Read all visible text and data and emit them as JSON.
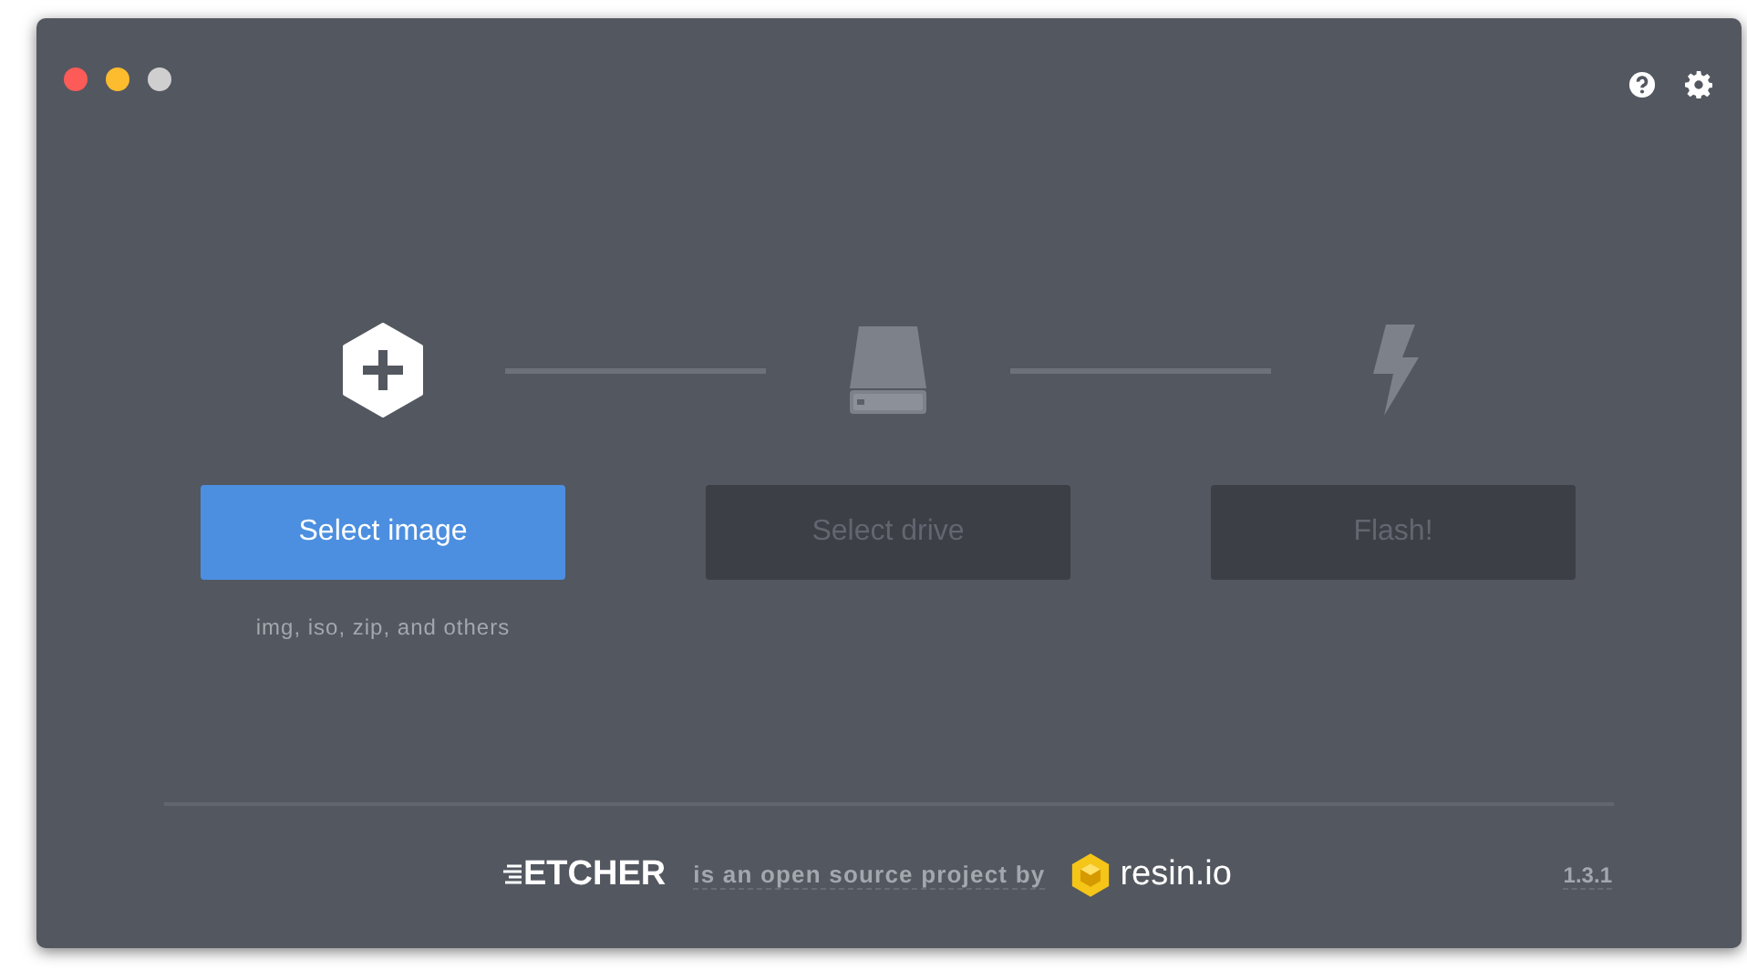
{
  "window": {
    "controls": [
      {
        "color": "#fc5b57"
      },
      {
        "color": "#fdbc2d"
      },
      {
        "color": "#cfcfcf"
      }
    ]
  },
  "steps": [
    {
      "kind": "image",
      "button": "Select image",
      "disabled": false,
      "caption": "img, iso, zip, and others"
    },
    {
      "kind": "drive",
      "button": "Select drive",
      "disabled": true
    },
    {
      "kind": "flash",
      "button": "Flash!",
      "disabled": true
    }
  ],
  "footer": {
    "logo": "ETCHER",
    "text": "is an open source project by",
    "brand": "resin.io",
    "version": "1.3.1"
  }
}
